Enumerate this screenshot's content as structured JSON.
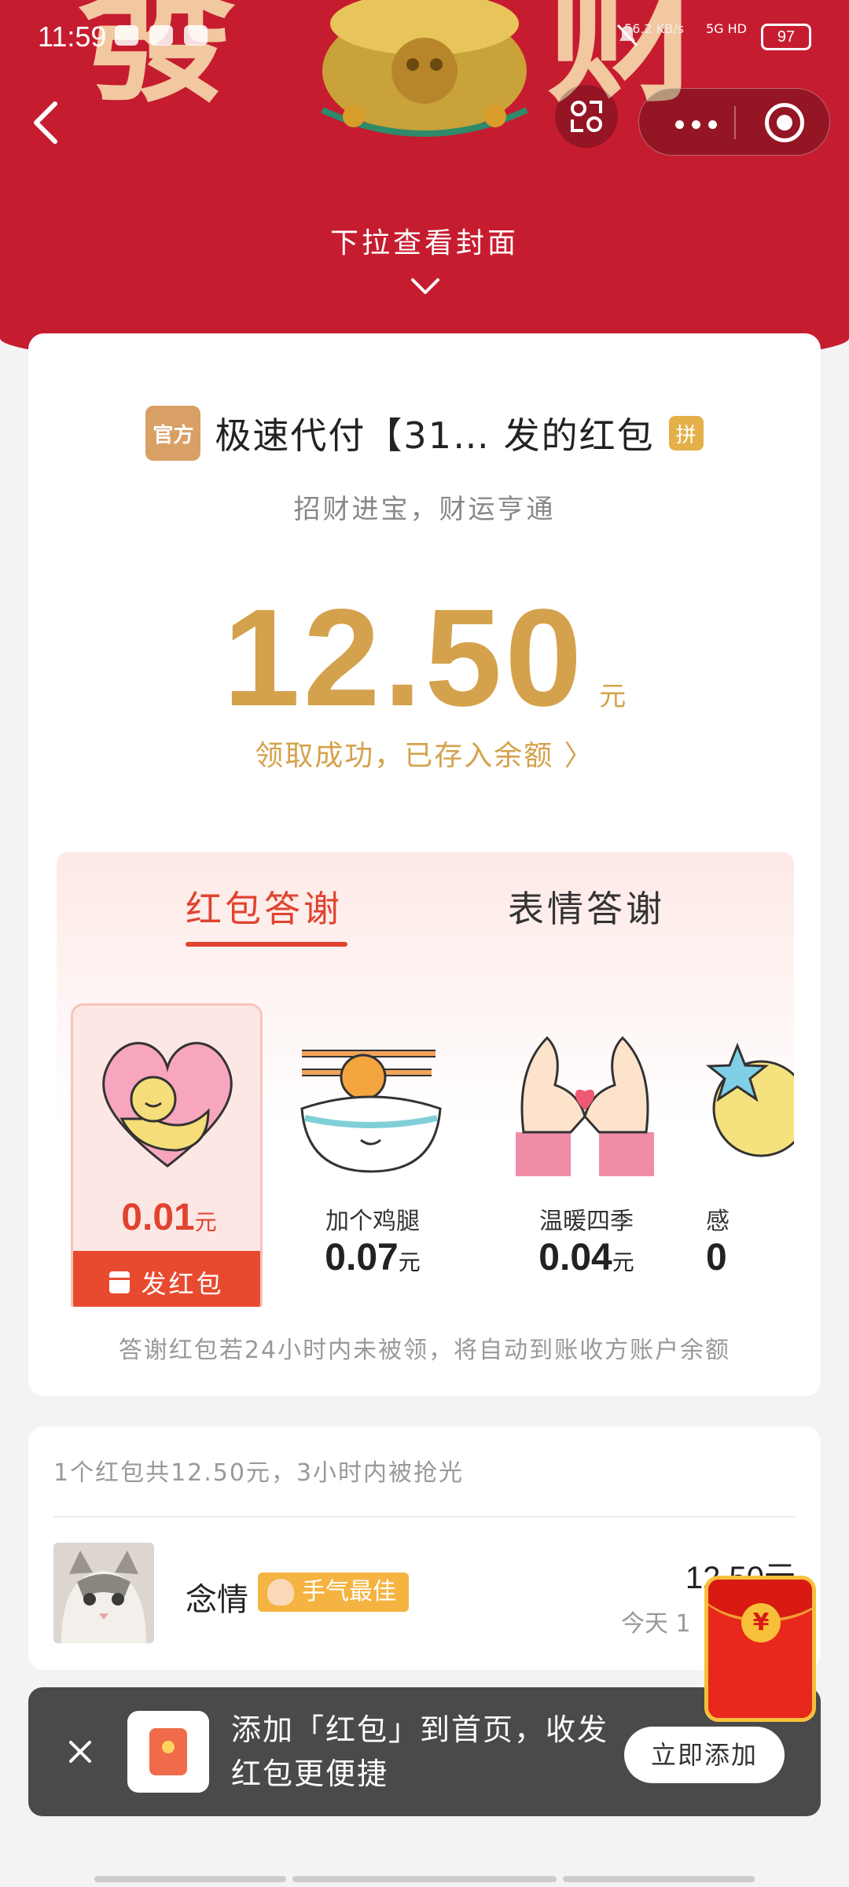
{
  "status_bar": {
    "time": "11:59",
    "net_speed": "56.2 KB/s",
    "network": "5G HD",
    "battery": "97"
  },
  "header": {
    "cover_chars": [
      "發",
      "财"
    ],
    "pull_hint": "下拉查看封面"
  },
  "packet": {
    "official_badge": "官方",
    "sender": "极速代付【31… 发的红包",
    "pin_badge": "拼",
    "wish": "招财进宝，财运亨通",
    "amount": "12.50",
    "amount_unit": "元",
    "received_text": "领取成功，已存入余额 〉"
  },
  "thanks": {
    "tabs": [
      "红包答谢",
      "表情答谢"
    ],
    "gifts": [
      {
        "name": "",
        "price": "0.01",
        "unit": "元",
        "icon": "heart-hug-icon"
      },
      {
        "name": "加个鸡腿",
        "price": "0.07",
        "unit": "元",
        "icon": "rice-bowl-icon"
      },
      {
        "name": "温暖四季",
        "price": "0.04",
        "unit": "元",
        "icon": "heart-hands-icon"
      },
      {
        "name": "感",
        "price": "0",
        "unit": "",
        "icon": "star-icon"
      }
    ],
    "send_label": "发红包",
    "note": "答谢红包若24小时内未被领，将自动到账收方账户余额"
  },
  "records": {
    "summary": "1个红包共12.50元，3小时内被抢光",
    "items": [
      {
        "name": "念情",
        "badge": "手气最佳",
        "amount": "12.50元",
        "time": "今天 1"
      }
    ]
  },
  "banner": {
    "message": "添加「红包」到首页，收发红包更便捷",
    "add_label": "立即添加"
  },
  "float_icon": "¥",
  "colors": {
    "header_red": "#c61c30",
    "gold": "#d4a24c",
    "accent_red": "#e0432f"
  }
}
